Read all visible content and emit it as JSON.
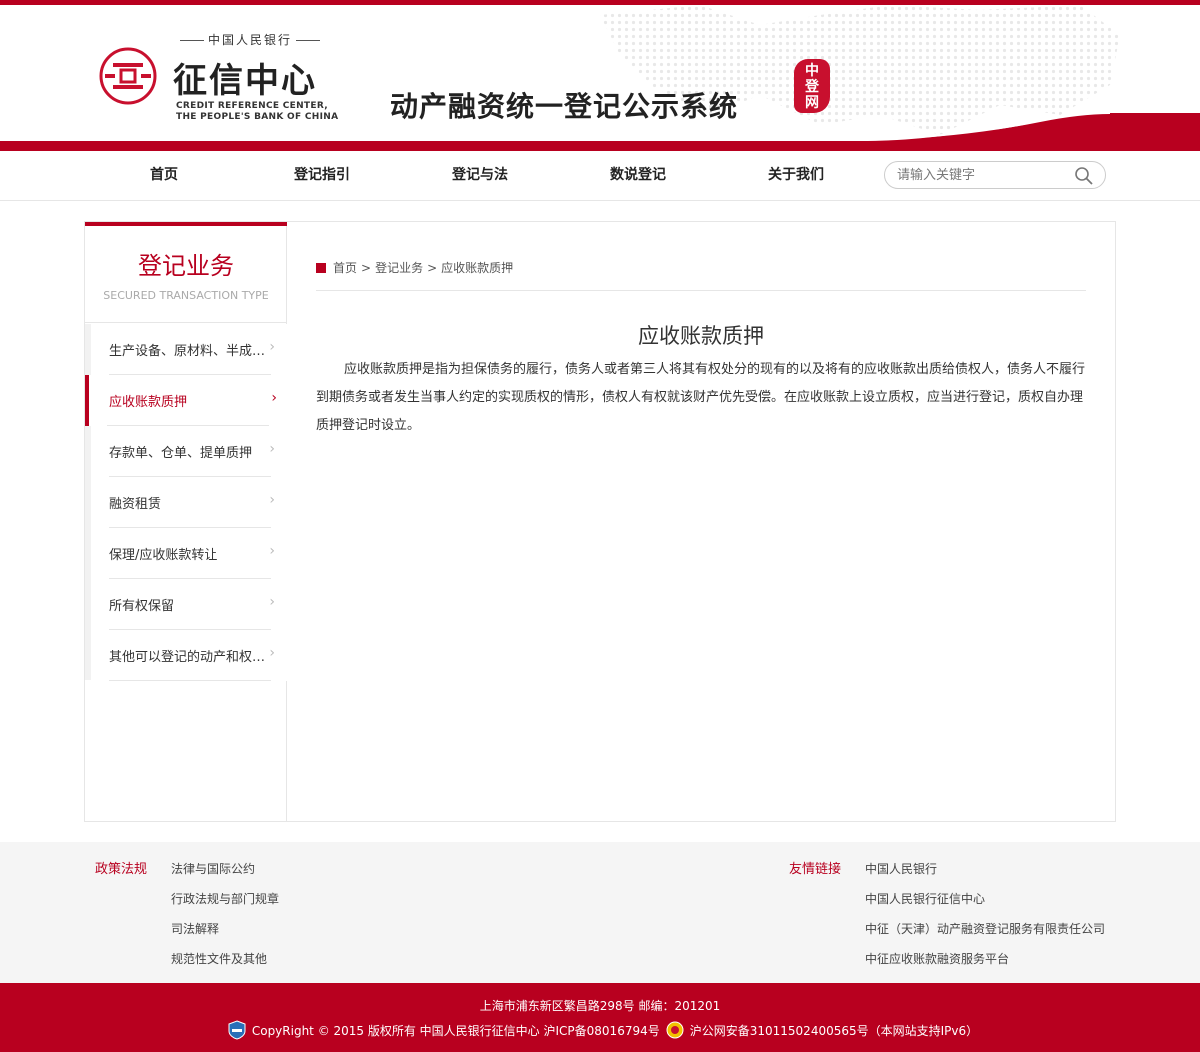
{
  "colors": {
    "brand_red": "#b8001f",
    "accent": "#c8102e"
  },
  "header": {
    "logo_super": "中国人民银行",
    "logo_cn": "征信中心",
    "logo_en_line1": "CREDIT REFERENCE CENTER,",
    "logo_en_line2": "THE PEOPLE'S BANK OF CHINA",
    "system_title": "动产融资统一登记公示系统",
    "seal_text": "中登网"
  },
  "nav": {
    "items": [
      {
        "label": "首页"
      },
      {
        "label": "登记指引"
      },
      {
        "label": "登记与法"
      },
      {
        "label": "数说登记"
      },
      {
        "label": "关于我们"
      }
    ],
    "search_placeholder": "请输入关键字"
  },
  "sidebar": {
    "title": "登记业务",
    "subtitle": "SECURED TRANSACTION TYPE",
    "items": [
      {
        "label": "生产设备、原材料、半成品、产品抵押",
        "active": false
      },
      {
        "label": "应收账款质押",
        "active": true
      },
      {
        "label": "存款单、仓单、提单质押",
        "active": false
      },
      {
        "label": "融资租赁",
        "active": false
      },
      {
        "label": "保理/应收账款转让",
        "active": false
      },
      {
        "label": "所有权保留",
        "active": false
      },
      {
        "label": "其他可以登记的动产和权利担保",
        "active": false
      }
    ],
    "arrow": "›"
  },
  "breadcrumb": {
    "home": "首页",
    "section": "登记业务",
    "current": "应收账款质押",
    "sep": ">"
  },
  "article": {
    "title": "应收账款质押",
    "body": "应收账款质押是指为担保债务的履行，债务人或者第三人将其有权处分的现有的以及将有的应收账款出质给债权人，债务人不履行到期债务或者发生当事人约定的实现质权的情形，债权人有权就该财产优先受偿。在应收账款上设立质权，应当进行登记，质权自办理质押登记时设立。"
  },
  "footer_links": {
    "policy_heading": "政策法规",
    "policy": [
      "法律与国际公约",
      "行政法规与部门规章",
      "司法解释",
      "规范性文件及其他"
    ],
    "friends_heading": "友情链接",
    "friends": [
      "中国人民银行",
      "中国人民银行征信中心",
      "中征（天津）动产融资登记服务有限责任公司",
      "中征应收账款融资服务平台"
    ]
  },
  "footer": {
    "address": "上海市浦东新区繁昌路298号 邮编：201201",
    "copyright": "CopyRight © 2015 版权所有 中国人民银行征信中心 沪ICP备08016794号",
    "police": "沪公网安备31011502400565号（本网站支持IPv6）"
  }
}
